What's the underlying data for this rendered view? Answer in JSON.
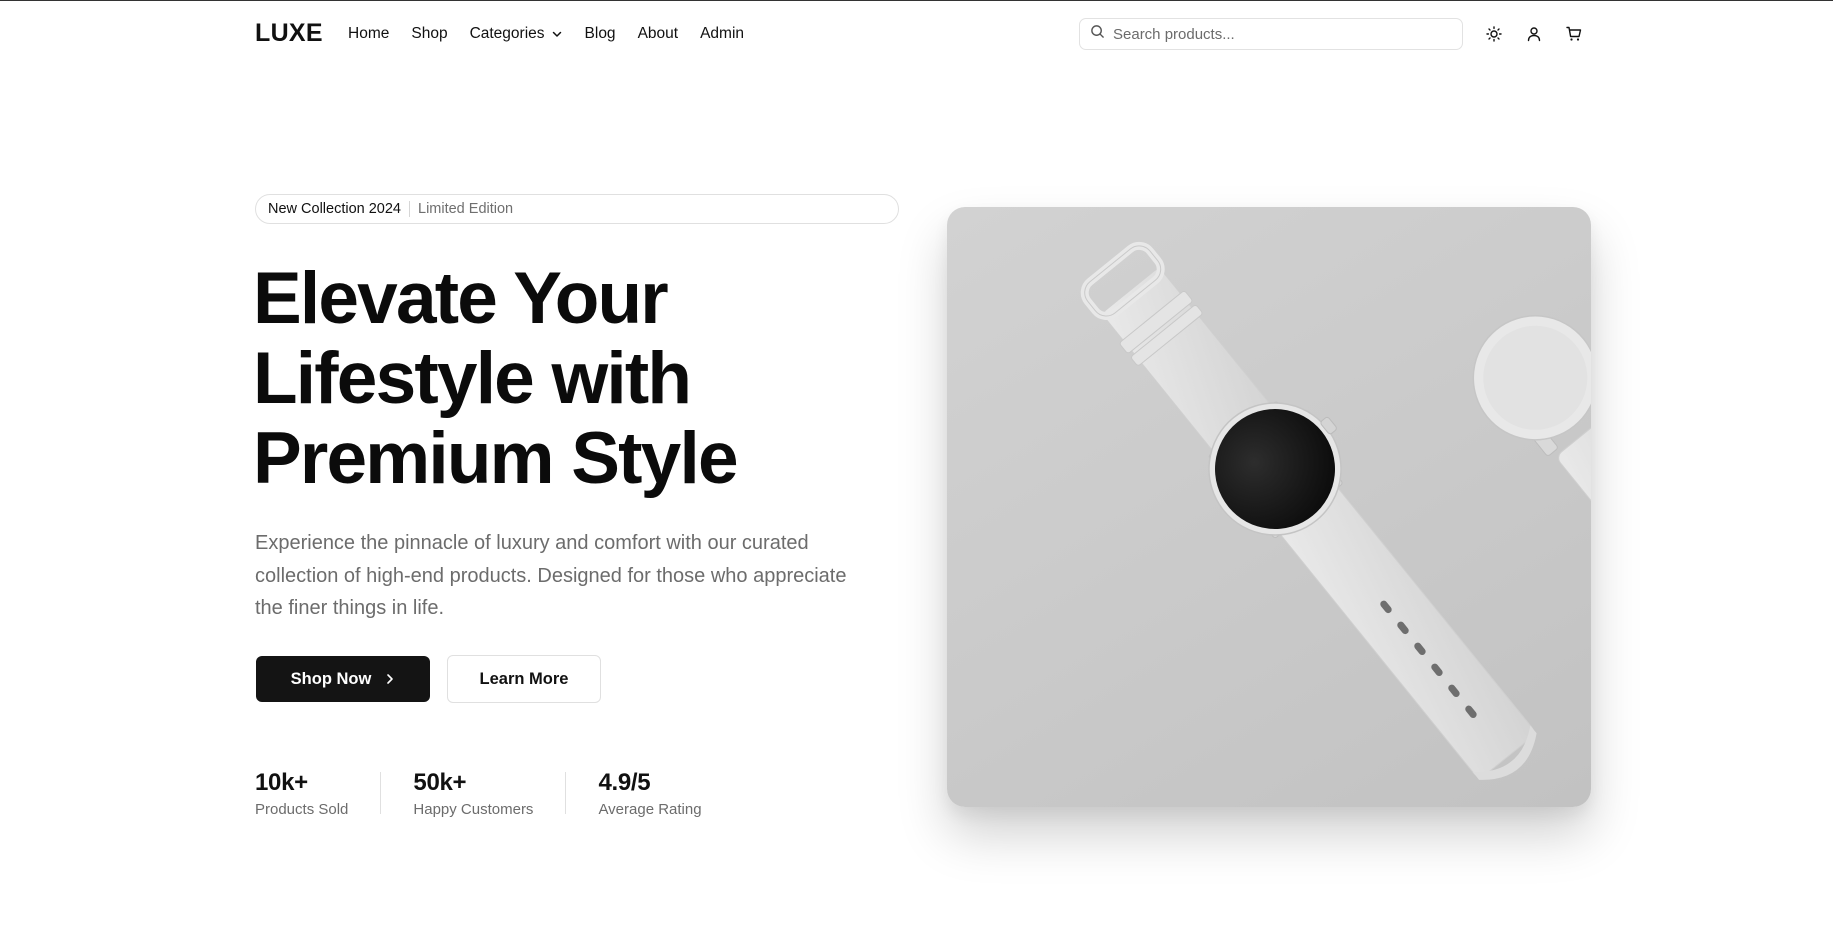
{
  "header": {
    "logo": "LUXE",
    "menu": [
      {
        "label": "Home"
      },
      {
        "label": "Shop"
      },
      {
        "label": "Categories",
        "has_dropdown": true
      },
      {
        "label": "Blog"
      },
      {
        "label": "About"
      },
      {
        "label": "Admin"
      }
    ],
    "search": {
      "placeholder": "Search products...",
      "value": "",
      "icon": "search-icon"
    },
    "icons": [
      "sun-icon",
      "user-icon",
      "cart-icon"
    ]
  },
  "hero": {
    "badge": {
      "primary": "New Collection 2024",
      "secondary": "Limited Edition"
    },
    "headline": [
      "Elevate Your",
      "Lifestyle with",
      "Premium Style"
    ],
    "description": "Experience the pinnacle of luxury and comfort with our curated collection of high-end products. Designed for those who appreciate the finer things in life.",
    "buttons": {
      "primary": "Shop Now",
      "secondary": "Learn More"
    },
    "stats": [
      {
        "value": "10k+",
        "label": "Products Sold"
      },
      {
        "value": "50k+",
        "label": "Happy Customers"
      },
      {
        "value": "4.9/5",
        "label": "Average Rating"
      }
    ]
  },
  "colors": {
    "primary_button": "#141414",
    "text": "#111111",
    "muted_text": "#6c6c6c",
    "border": "#e0e0e0"
  }
}
